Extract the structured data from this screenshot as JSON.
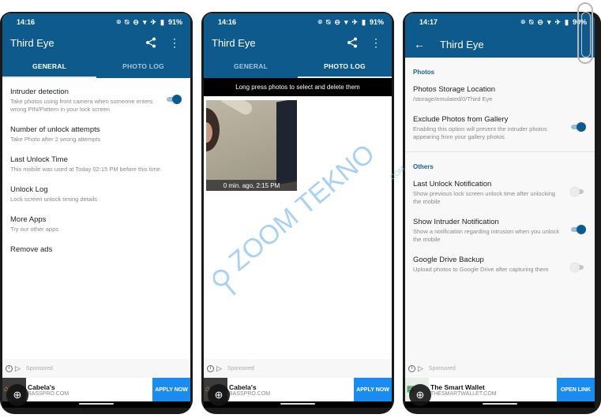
{
  "colors": {
    "primary": "#0e5a8c",
    "accent_cta": "#1a8cf0",
    "section_header": "#1f5f8f",
    "banner_bg": "#000000"
  },
  "watermark": {
    "text": "ZOOM TEKNO",
    "suffix": ".COM"
  },
  "screens": [
    {
      "status": {
        "time": "14:16",
        "battery": "91%",
        "icons": [
          "location-icon",
          "notifications-off-icon",
          "do-not-disturb-icon",
          "wifi-icon",
          "airplane-icon",
          "battery-icon"
        ]
      },
      "app_title": "Third Eye",
      "toolbar_icons": [
        "share-icon",
        "more-vert-icon"
      ],
      "tabs": [
        {
          "label": "GENERAL",
          "active": true
        },
        {
          "label": "PHOTO LOG",
          "active": false
        }
      ],
      "items": [
        {
          "title": "Intruder detection",
          "subtitle": "Take photos using front camera when someone enters wrong PIN/Pattern in your lock screen",
          "toggle": true
        },
        {
          "title": "Number of unlock attempts",
          "subtitle": "Take Photo after 2 wrong attempts"
        },
        {
          "title": "Last Unlock Time",
          "subtitle": "This mobile was used at Today  02:15 PM before this time."
        },
        {
          "title": "Unlock Log",
          "subtitle": "Lock screen unlock timing details"
        },
        {
          "title": "More Apps",
          "subtitle": "Try our other apps"
        },
        {
          "title": "Remove ads",
          "subtitle": ""
        }
      ],
      "ad": {
        "sponsored": "Sponsored",
        "name": "Cabela's",
        "domain": "BASSPRO.COM",
        "cta": "APPLY NOW"
      }
    },
    {
      "status": {
        "time": "14:16",
        "battery": "91%"
      },
      "app_title": "Third Eye",
      "tabs": [
        {
          "label": "GENERAL",
          "active": false
        },
        {
          "label": "PHOTO LOG",
          "active": true
        }
      ],
      "banner": "Long press photos to select and delete them",
      "photos": [
        {
          "caption": "0 min. ago, 2:15 PM"
        }
      ],
      "ad": {
        "sponsored": "Sponsored",
        "name": "Cabela's",
        "domain": "BASSPRO.COM",
        "cta": "APPLY NOW"
      }
    },
    {
      "status": {
        "time": "14:17",
        "battery": "90%"
      },
      "app_title": "Third Eye",
      "sections": [
        {
          "header": "Photos",
          "items": [
            {
              "title": "Photos Storage Location",
              "subtitle": "/storage/emulated/0/Third Eye"
            },
            {
              "title": "Exclude Photos from Gallery",
              "subtitle": "Enabling this option will prevent the intruder photos appearing from your gallery photos",
              "toggle": true
            }
          ]
        },
        {
          "header": "Others",
          "items": [
            {
              "title": "Last Unlock Notification",
              "subtitle": "Show previous lock screen unlock time after unlocking the mobile",
              "toggle": false
            },
            {
              "title": "Show Intruder Notification",
              "subtitle": "Show a notification regarding intrusion when you unlock the mobile",
              "toggle": true
            },
            {
              "title": "Google Drive Backup",
              "subtitle": "Upload photos to Google Drive after capturing them",
              "toggle": false
            }
          ]
        }
      ],
      "ad": {
        "sponsored": "Sponsored",
        "name": "The Smart Wallet",
        "domain": "THESMARTWALLET.COM",
        "cta": "OPEN LINK"
      }
    }
  ]
}
